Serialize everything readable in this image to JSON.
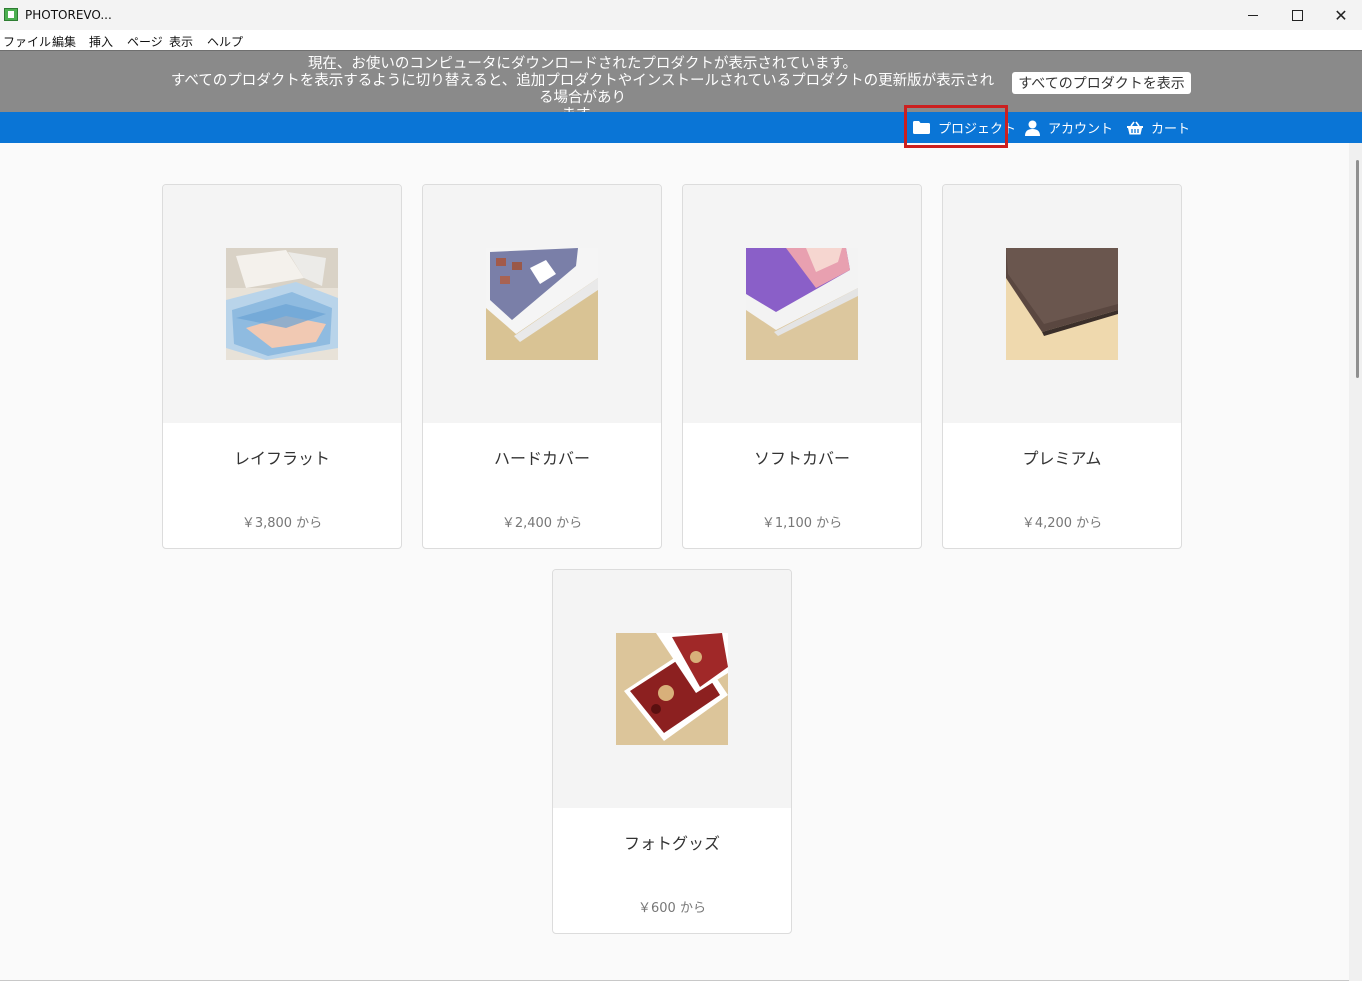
{
  "window": {
    "title": "PHOTOREVO..."
  },
  "menu": [
    {
      "label": "ファイル"
    },
    {
      "label": "編集"
    },
    {
      "label": "挿入"
    },
    {
      "label": "ページ"
    },
    {
      "label": "表示"
    },
    {
      "label": "ヘルプ"
    }
  ],
  "notice": {
    "line1": "現在、お使いのコンピュータにダウンロードされたプロダクトが表示されています。",
    "line2": "すべてのプロダクトを表示するように切り替えると、追加プロダクトやインストールされているプロダクトの更新版が表示される場合があり",
    "line3": "ます。",
    "button_label": "すべてのプロダクトを表示"
  },
  "nav": {
    "projects": "プロジェクト",
    "account": "アカウント",
    "cart": "カート"
  },
  "products": [
    {
      "name": "レイフラット",
      "price": "￥3,800 から",
      "icon": "layflat-photobook-thumbnail"
    },
    {
      "name": "ハードカバー",
      "price": "￥2,400 から",
      "icon": "hardcover-photobook-thumbnail"
    },
    {
      "name": "ソフトカバー",
      "price": "￥1,100 から",
      "icon": "softcover-photobook-thumbnail"
    },
    {
      "name": "プレミアム",
      "price": "￥4,200 から",
      "icon": "premium-photobook-thumbnail"
    },
    {
      "name": "フォトグッズ",
      "price": "￥600 から",
      "icon": "photo-goods-thumbnail"
    }
  ],
  "colors": {
    "nav_blue": "#0a75d6",
    "notice_gray": "#8a8a8a",
    "highlight_red": "#cc1f1f"
  }
}
